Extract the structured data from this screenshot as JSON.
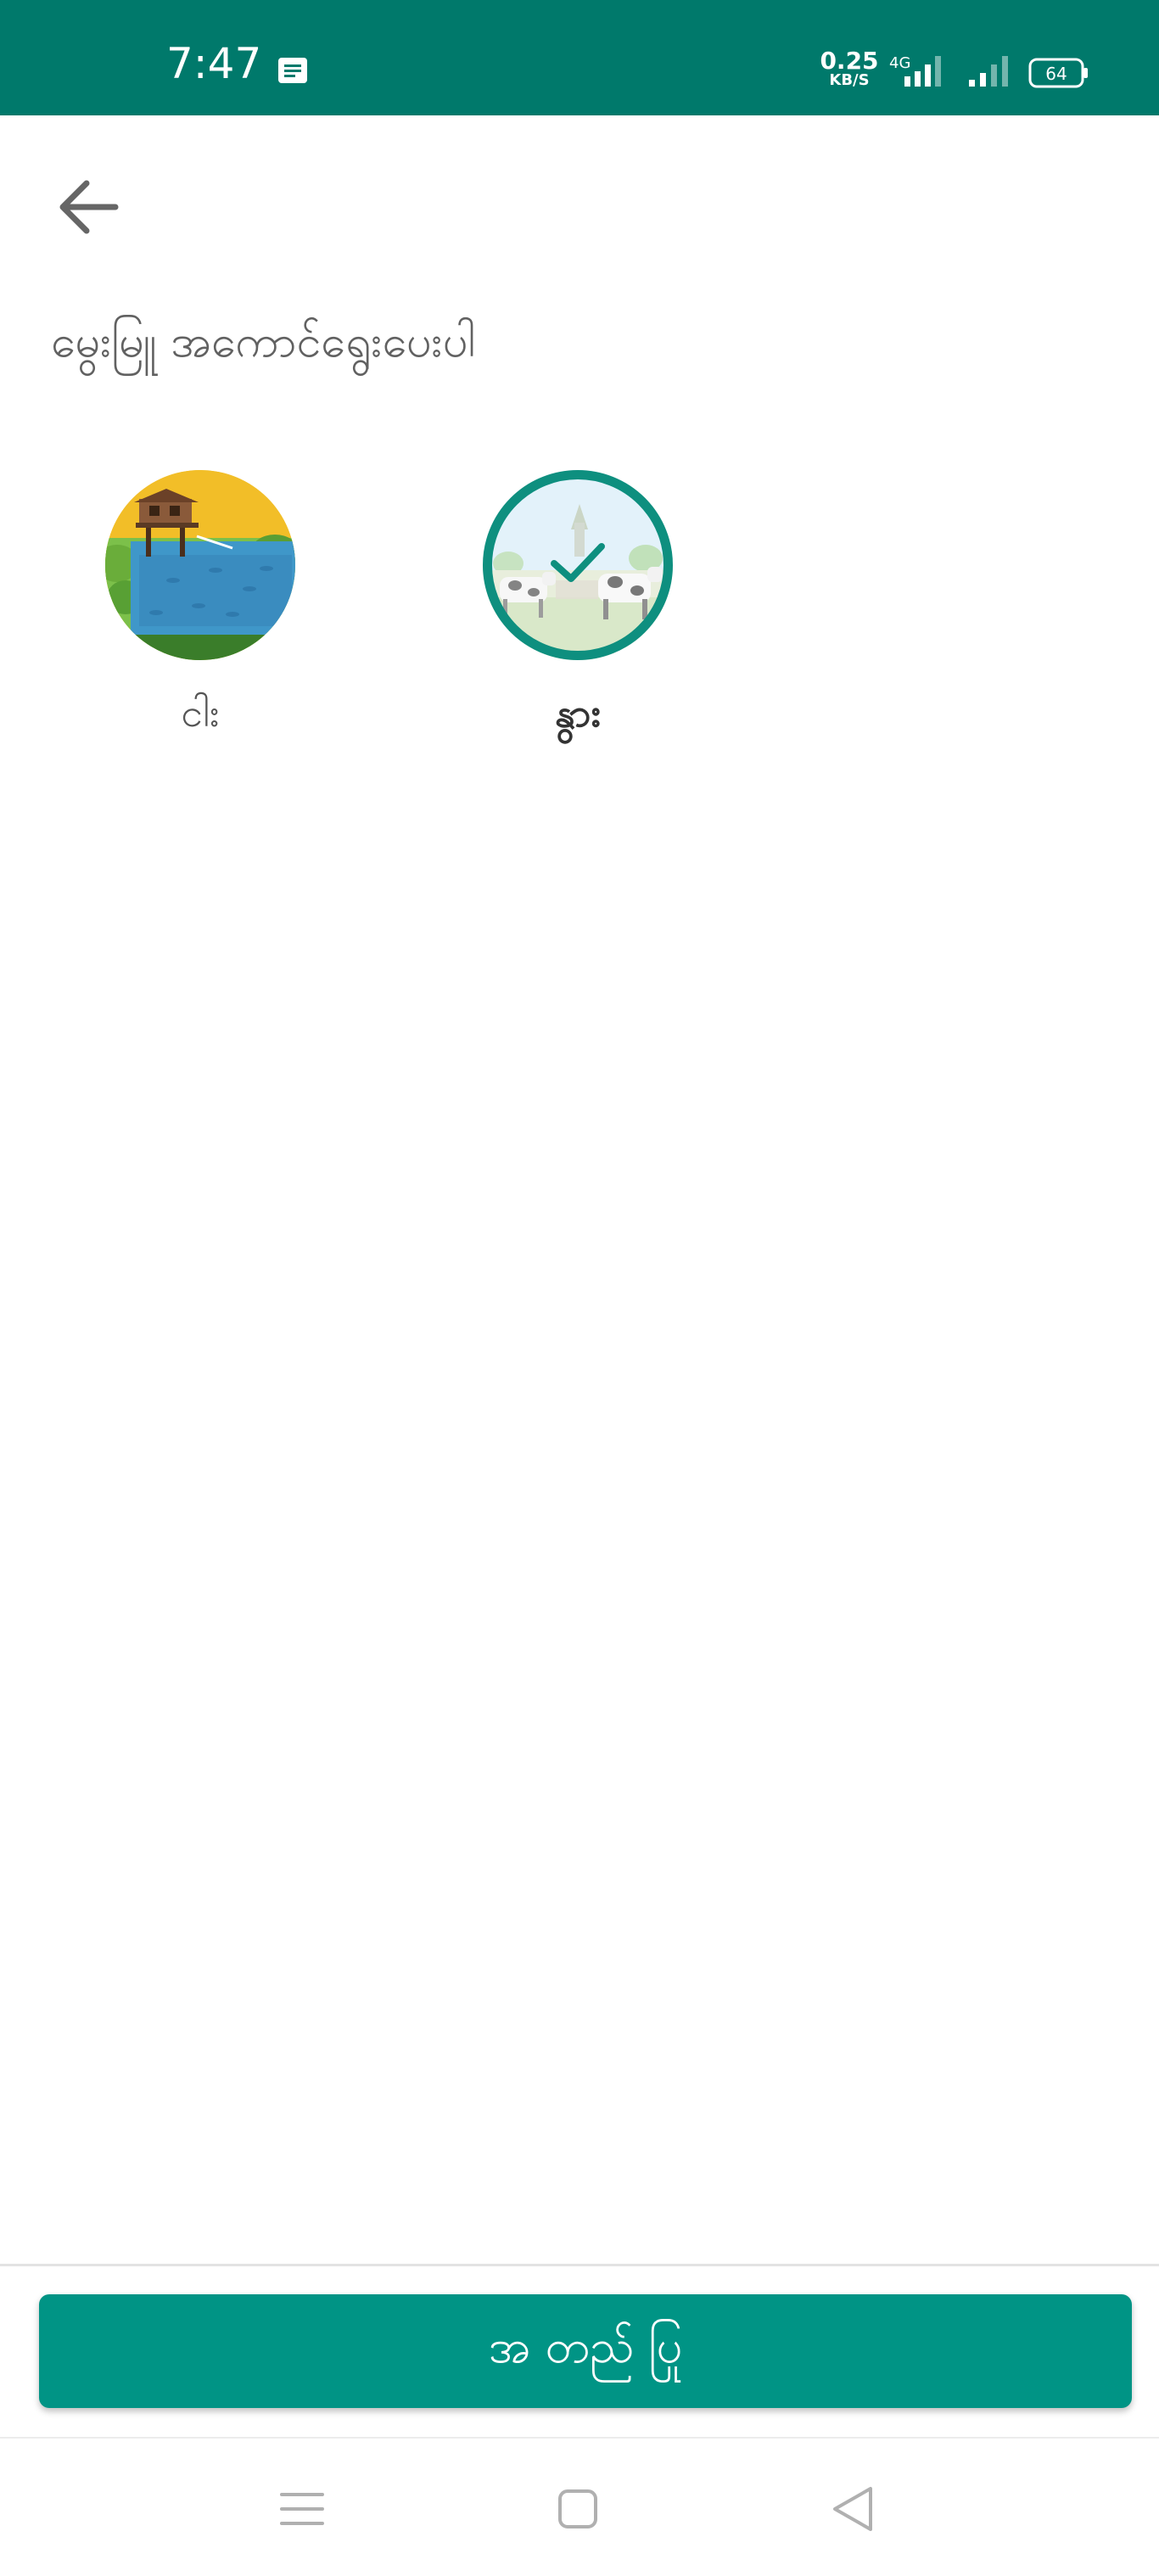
{
  "status_bar": {
    "time": "7:47",
    "message_icon": "message-icon",
    "speed_value": "0.25",
    "speed_unit": "KB/S",
    "network_type": "4G",
    "battery_level": "64"
  },
  "header": {
    "back_icon": "arrow-left-icon",
    "title": "မွေးမြူ အကောင်ရွေးပေးပါ"
  },
  "options": [
    {
      "label": "ငါး",
      "image": "fish-pond-illustration",
      "selected": false
    },
    {
      "label": "နွား",
      "image": "cattle-farm-illustration",
      "selected": true
    }
  ],
  "confirm_button": {
    "label": "အ တည် ပြု"
  },
  "nav_bar": {
    "menu_icon": "menu-icon",
    "home_icon": "home-square-icon",
    "back_icon": "back-triangle-icon"
  },
  "colors": {
    "primary": "#00796b",
    "accent": "#009485",
    "ring": "#0e8f7f"
  }
}
